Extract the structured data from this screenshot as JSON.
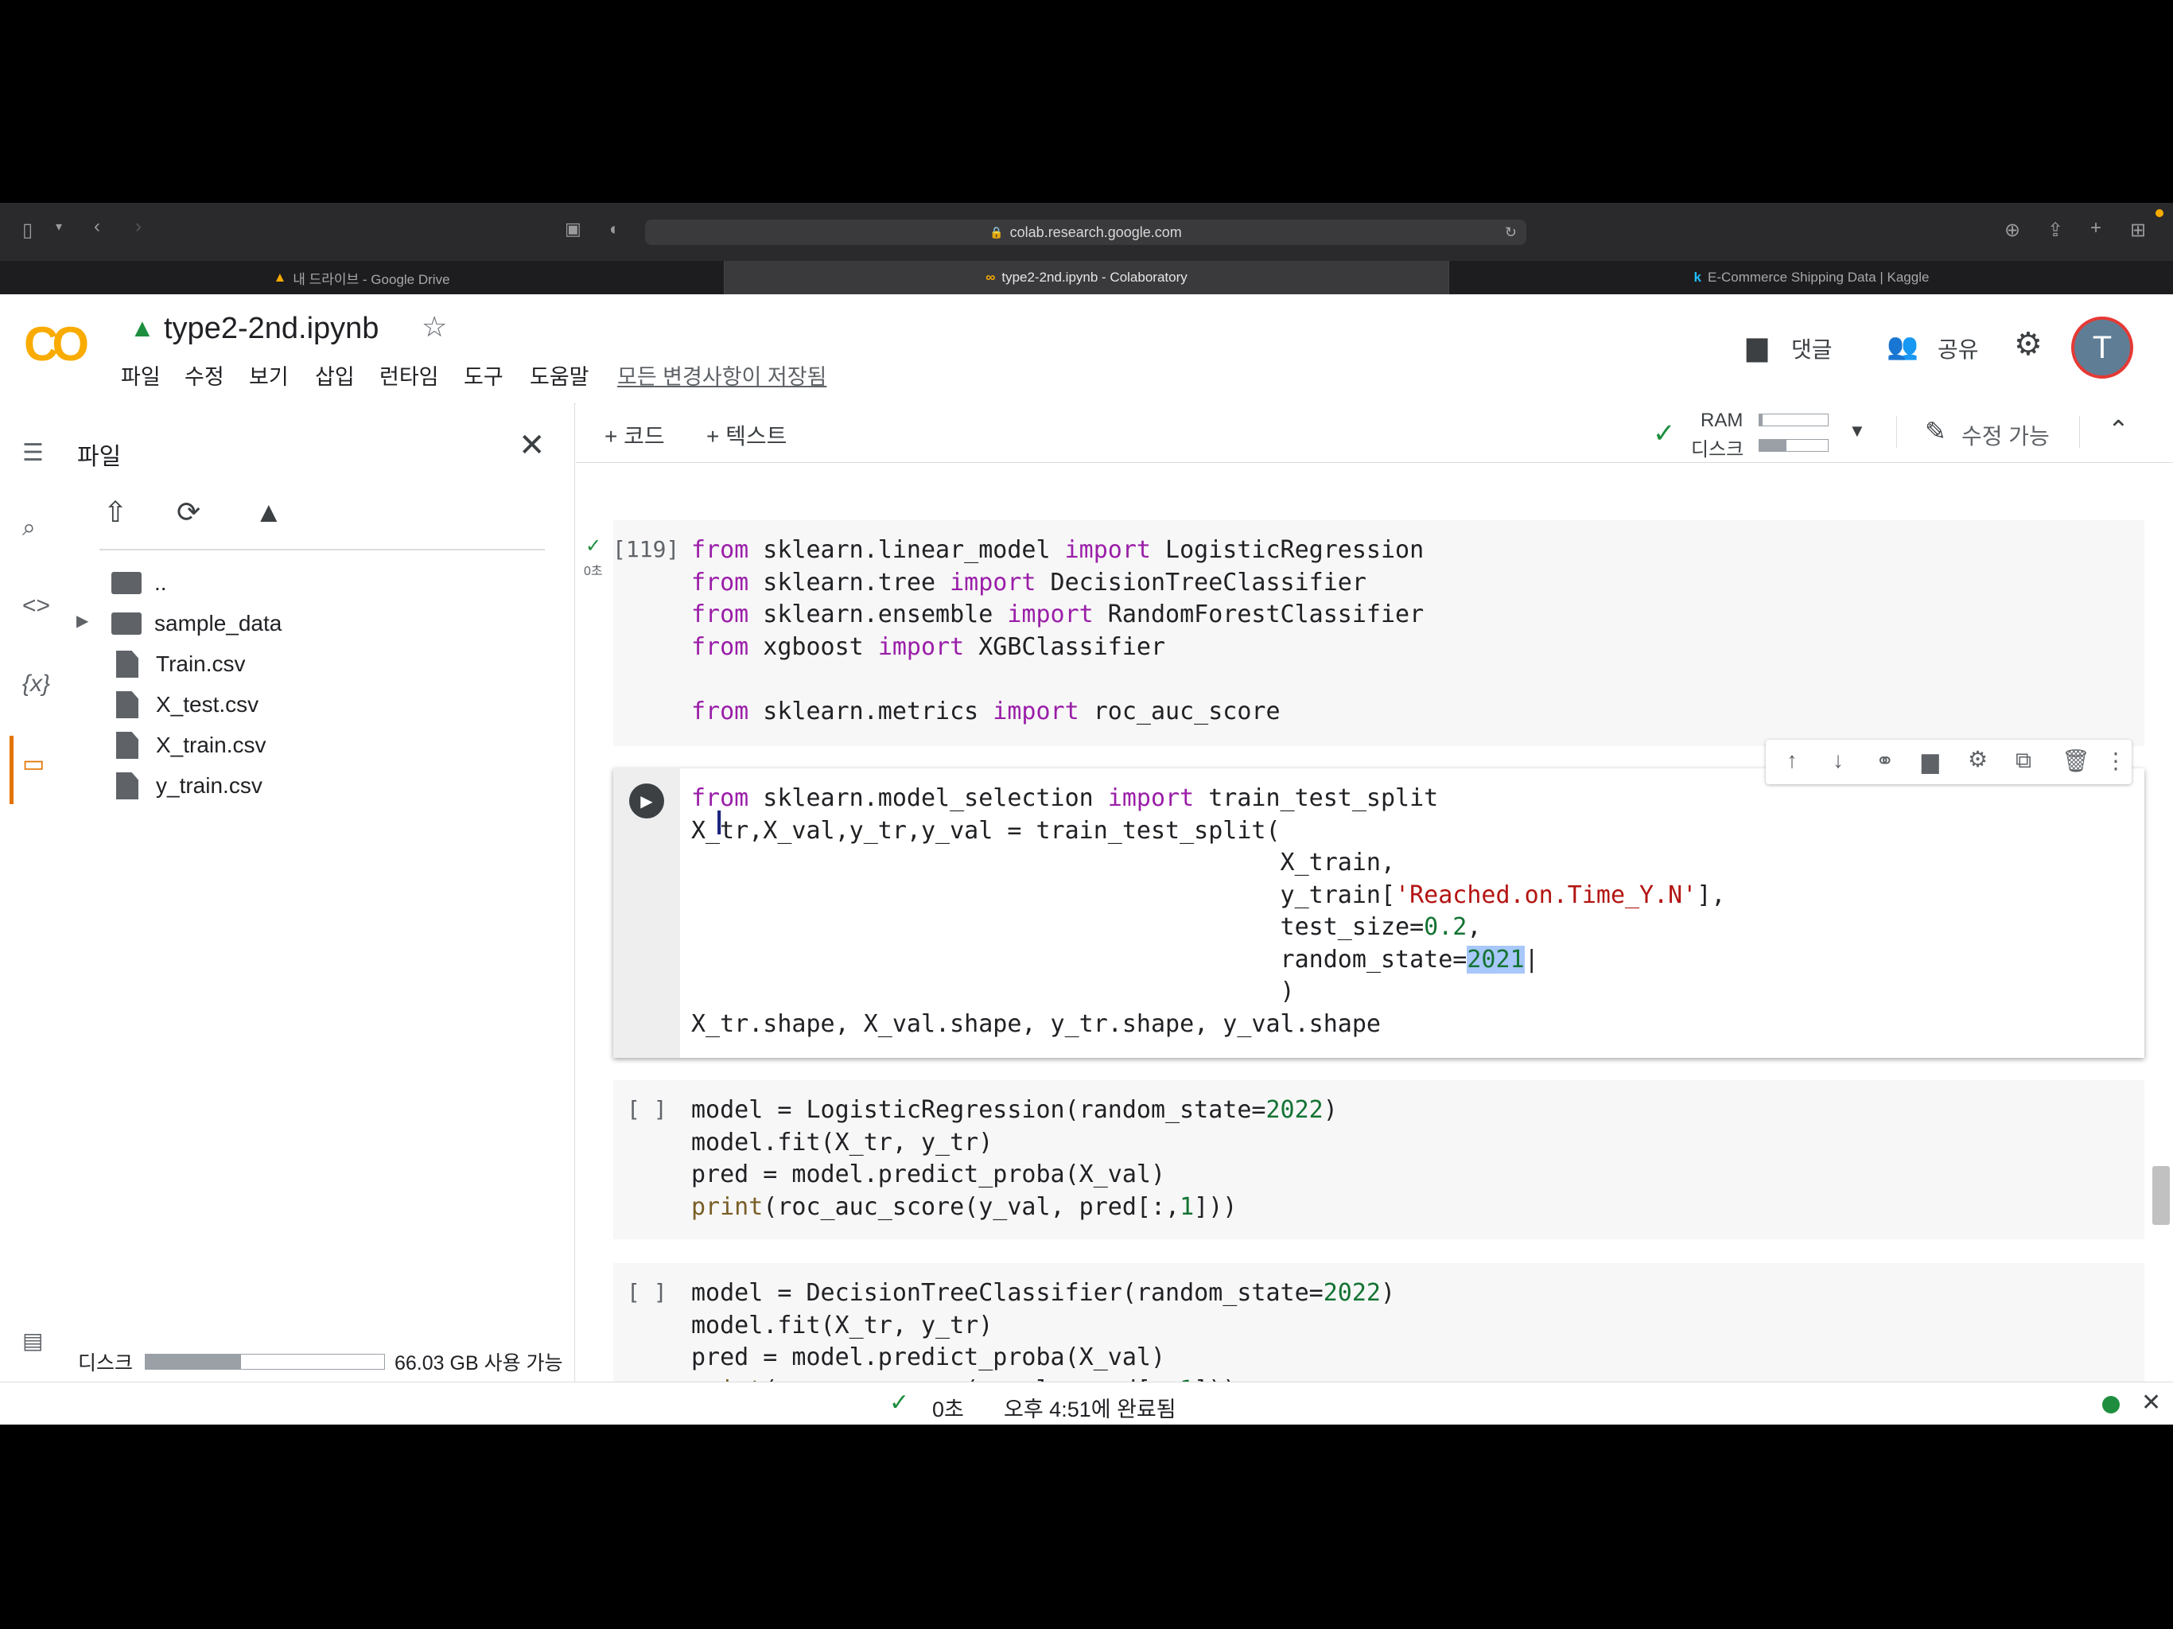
{
  "browser": {
    "url": "colab.research.google.com",
    "tabs": [
      {
        "label": "내 드라이브 - Google Drive",
        "active": false
      },
      {
        "label": "type2-2nd.ipynb - Colaboratory",
        "active": true
      },
      {
        "label": "E-Commerce Shipping Data | Kaggle",
        "active": false
      }
    ]
  },
  "colab": {
    "logo": "CO",
    "title": "type2-2nd.ipynb",
    "menu": [
      "파일",
      "수정",
      "보기",
      "삽입",
      "런타임",
      "도구",
      "도움말"
    ],
    "saved_status": "모든 변경사항이 저장됨",
    "comment_label": "댓글",
    "share_label": "공유",
    "avatar_letter": "T",
    "add_code": "+ 코드",
    "add_text": "+ 텍스트",
    "ram_label": "RAM",
    "disk_label": "디스크",
    "ram_usage": 0.05,
    "disk_usage": 0.4,
    "edit_mode": "수정 가능"
  },
  "sidebar": {
    "title": "파일",
    "tree": [
      {
        "name": "..",
        "type": "parent"
      },
      {
        "name": "sample_data",
        "type": "folder"
      },
      {
        "name": "Train.csv",
        "type": "file"
      },
      {
        "name": "X_test.csv",
        "type": "file"
      },
      {
        "name": "X_train.csv",
        "type": "file"
      },
      {
        "name": "y_train.csv",
        "type": "file"
      }
    ],
    "disk_label": "디스크",
    "disk_usage": 0.4,
    "disk_available": "66.03 GB 사용 가능"
  },
  "cells": {
    "c1_prompt": "[119]",
    "c1_time": "0초",
    "c3_prompt": "[ ]",
    "c4_prompt": "[ ]"
  },
  "status": {
    "duration": "0초",
    "completed": "오후 4:51에 완료됨"
  },
  "colors": {
    "keyword": "#9a1ea8",
    "number": "#137333",
    "string": "#b31412",
    "accent": "#f9ab00",
    "success": "#1e8e3e"
  }
}
